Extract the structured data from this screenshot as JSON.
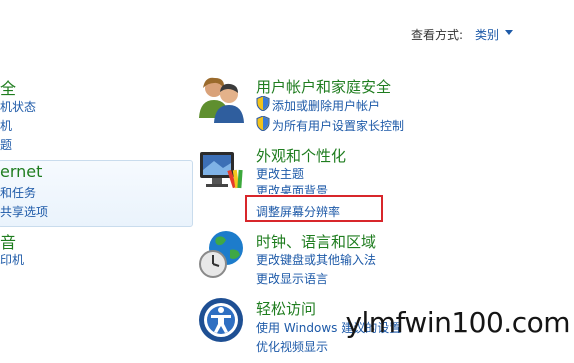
{
  "header": {
    "view_by_label": "查看方式:",
    "view_by_value": "类别"
  },
  "left_column": {
    "section1": {
      "heading": "全",
      "links": [
        "机状态",
        "机",
        "题"
      ]
    },
    "section2": {
      "heading": "ernet",
      "links": [
        "和任务",
        "共享选项"
      ]
    },
    "section3": {
      "heading": "音",
      "links": [
        "印机"
      ]
    }
  },
  "categories": [
    {
      "title": "用户帐户和家庭安全",
      "icon": "users-icon",
      "links": [
        "添加或删除用户帐户",
        "为所有用户设置家长控制"
      ]
    },
    {
      "title": "外观和个性化",
      "icon": "monitor-icon",
      "links": [
        "更改主题",
        "更改桌面背景",
        "调整屏幕分辨率"
      ]
    },
    {
      "title": "时钟、语言和区域",
      "icon": "globe-clock-icon",
      "links": [
        "更改键盘或其他输入法",
        "更改显示语言"
      ]
    },
    {
      "title": "轻松访问",
      "icon": "ease-of-access-icon",
      "links": [
        "使用 Windows 建议的设置",
        "优化视频显示"
      ]
    }
  ],
  "watermark": "ylmfwin100.com",
  "colors": {
    "link": "#1e5aa8",
    "heading": "#1f7d1f",
    "highlight": "#d8262b"
  }
}
